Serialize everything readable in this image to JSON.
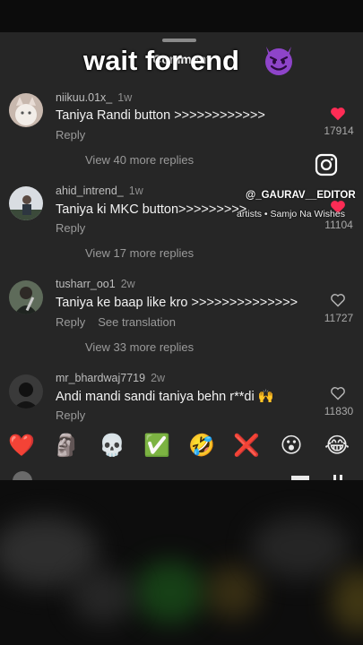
{
  "overlay": {
    "title": "wait for end",
    "title_emoji": "smiling-face-with-horns",
    "watermark_handle": "@_GAURAV__EDITOR",
    "watermark_credit": "artists • Samjo Na Wishes"
  },
  "sheet": {
    "title": "Comment"
  },
  "comments": [
    {
      "username": "niikuu.01x_",
      "time": "1w",
      "text": "Taniya Randi button >>>>>>>>>>>>",
      "reply": "Reply",
      "likes": "17914",
      "liked": true,
      "view_more": "View 40 more replies"
    },
    {
      "username": "ahid_intrend_",
      "time": "1w",
      "text": "Taniya ki MKC button>>>>>>>>>",
      "reply": "Reply",
      "likes": "11104",
      "liked": true,
      "view_more": "View 17 more replies"
    },
    {
      "username": "tusharr_oo1",
      "time": "2w",
      "text": "Taniya ke baap like kro >>>>>>>>>>>>>>",
      "reply": "Reply",
      "see_translation": "See translation",
      "likes": "11727",
      "liked": false,
      "view_more": "View 33 more replies"
    },
    {
      "username": "mr_bhardwaj7719",
      "time": "2w",
      "text": "Andi mandi sandi taniya behn r**di 🙌",
      "reply": "Reply",
      "likes": "11830",
      "liked": false
    }
  ],
  "emoji_bar": [
    "❤️",
    "🗿",
    "💀",
    "✅",
    "🤣",
    "❌",
    "😮",
    "😂"
  ],
  "colors": {
    "like_red": "#fe2c55",
    "sheet_bg": "#262626",
    "page_bg": "#0c0c0c"
  }
}
